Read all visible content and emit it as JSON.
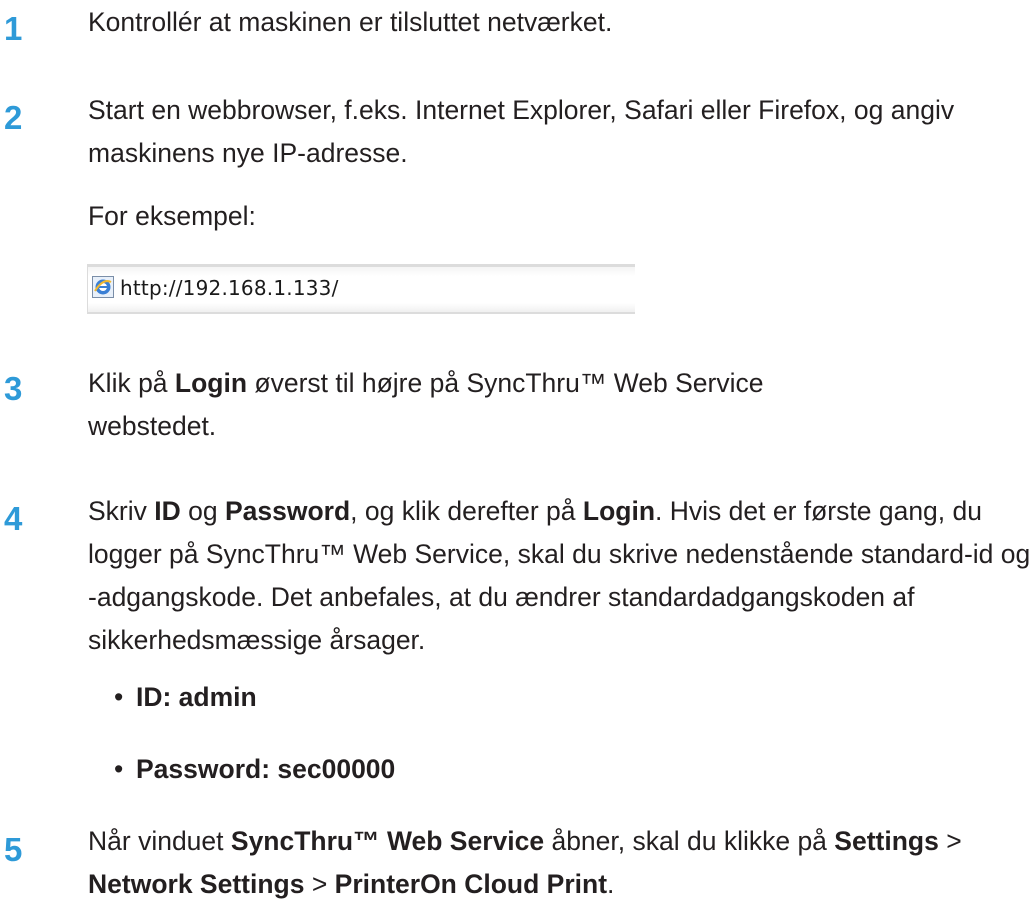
{
  "steps": [
    {
      "number": "1",
      "lines": [
        "Kontrollér at maskinen er tilsluttet netværket."
      ]
    },
    {
      "number": "2",
      "text": "Start en webbrowser, f.eks. Internet Explorer, Safari eller Firefox, og angiv maskinens nye IP-adresse.",
      "example_label": "For eksempel:",
      "example_url": "http://192.168.1.133/"
    },
    {
      "number": "3",
      "parts": [
        "Klik på ",
        "Login",
        " øverst til højre på SyncThru™ Web Service webstedet."
      ]
    },
    {
      "number": "4",
      "parts": [
        "Skriv ",
        "ID",
        " og ",
        "Password",
        ", og klik derefter på ",
        "Login",
        ". Hvis det er første gang, du logger på SyncThru™ Web Service, skal du skrive nedenstående standard-id og -adgangskode. Det anbefales, at du ændrer standardadgangskoden af sikkerhedsmæssige årsager."
      ],
      "bullets": [
        "ID: admin",
        "Password: sec00000"
      ]
    },
    {
      "number": "5",
      "parts": [
        "Når vinduet ",
        "SyncThru™ Web Service",
        " åbner, skal du klikke på ",
        "Settings",
        " > ",
        "Network Settings",
        " > ",
        "PrinterOn Cloud Print",
        "."
      ]
    }
  ],
  "bullet_symbol": "•",
  "icons": {
    "browser": "internet-explorer-icon"
  },
  "colors": {
    "step_number": "#2e9ad8",
    "text": "#231f20"
  }
}
